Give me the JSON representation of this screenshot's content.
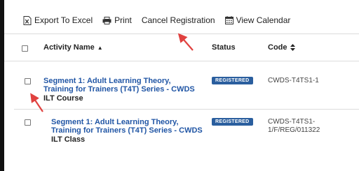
{
  "toolbar": {
    "export_label": "Export To Excel",
    "print_label": "Print",
    "cancel_label": "Cancel Registration",
    "calendar_label": "View Calendar"
  },
  "table": {
    "headers": {
      "activity_name": "Activity Name",
      "status": "Status",
      "code": "Code"
    },
    "rows": [
      {
        "title_line1": "Segment 1: Adult Learning Theory,",
        "title_line2": "Training for Trainers (T4T) Series - CWDS",
        "type": "ILT Course",
        "status": "REGISTERED",
        "code_line1": "CWDS-T4TS1-1",
        "code_line2": ""
      },
      {
        "title_line1": "Segment 1: Adult Learning Theory,",
        "title_line2": "Training for Trainers (T4T) Series - CWDS",
        "type": "ILT Class",
        "status": "REGISTERED",
        "code_line1": "CWDS-T4TS1-",
        "code_line2": "1/F/REG/011322"
      }
    ]
  },
  "icons": {
    "export": "excel-icon",
    "print": "printer-icon",
    "calendar": "calendar-icon",
    "sort_asc": "sort-ascending-icon",
    "sort_both": "sort-both-icon"
  },
  "colors": {
    "link": "#2156a5",
    "badge": "#2a5e9e",
    "annotation_arrow": "#e0413f"
  }
}
